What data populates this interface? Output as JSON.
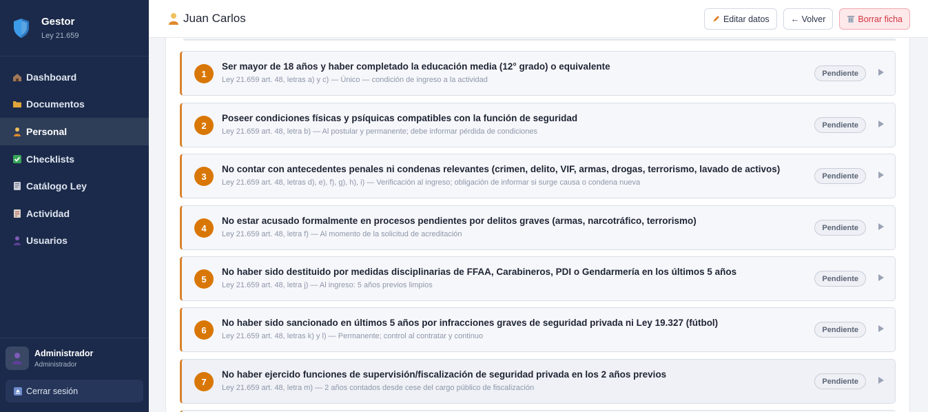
{
  "brand": {
    "title": "Gestor",
    "subtitle": "Ley 21.659"
  },
  "nav": [
    {
      "label": "Dashboard",
      "icon": "house-icon"
    },
    {
      "label": "Documentos",
      "icon": "folder-icon"
    },
    {
      "label": "Personal",
      "icon": "person-icon",
      "active": true
    },
    {
      "label": "Checklists",
      "icon": "checkbox-icon"
    },
    {
      "label": "Catálogo Ley",
      "icon": "book-icon"
    },
    {
      "label": "Actividad",
      "icon": "log-icon"
    },
    {
      "label": "Usuarios",
      "icon": "users-icon"
    }
  ],
  "user": {
    "name": "Administrador",
    "role": "Administrador"
  },
  "logout_label": "Cerrar sesión",
  "header": {
    "title": "Juan Carlos",
    "edit_label": "Editar datos",
    "back_label": "← Volver",
    "delete_label": "Borrar ficha"
  },
  "requirements": [
    {
      "num": "1",
      "title": "Ser mayor de 18 años y haber completado la educación media (12° grado) o equivalente",
      "sub": "Ley 21.659 art. 48, letras a) y c) — Único — condición de ingreso a la actividad",
      "status": "Pendiente"
    },
    {
      "num": "2",
      "title": "Poseer condiciones físicas y psíquicas compatibles con la función de seguridad",
      "sub": "Ley 21.659 art. 48, letra b) — Al postular y permanente; debe informar pérdida de condiciones",
      "status": "Pendiente"
    },
    {
      "num": "3",
      "title": "No contar con antecedentes penales ni condenas relevantes (crimen, delito, VIF, armas, drogas, terrorismo, lavado de activos)",
      "sub": "Ley 21.659 art. 48, letras d), e), f), g), h), i) — Verificación al ingreso; obligación de informar si surge causa o condena nueva",
      "status": "Pendiente"
    },
    {
      "num": "4",
      "title": "No estar acusado formalmente en procesos pendientes por delitos graves (armas, narcotráfico, terrorismo)",
      "sub": "Ley 21.659 art. 48, letra f) — Al momento de la solicitud de acreditación",
      "status": "Pendiente"
    },
    {
      "num": "5",
      "title": "No haber sido destituido por medidas disciplinarias de FFAA, Carabineros, PDI o Gendarmería en los últimos 5 años",
      "sub": "Ley 21.659 art. 48, letra j) — Al ingreso: 5 años previos limpios",
      "status": "Pendiente"
    },
    {
      "num": "6",
      "title": "No haber sido sancionado en últimos 5 años por infracciones graves de seguridad privada ni Ley 19.327 (fútbol)",
      "sub": "Ley 21.659 art. 48, letras k) y l) — Permanente; control al contratar y continuo",
      "status": "Pendiente"
    },
    {
      "num": "7",
      "title": "No haber ejercido funciones de supervisión/fiscalización de seguridad privada en los 2 años previos",
      "sub": "Ley 21.659 art. 48, letra m) — 2 años contados desde cese del cargo público de fiscalización",
      "status": "Pendiente"
    }
  ]
}
